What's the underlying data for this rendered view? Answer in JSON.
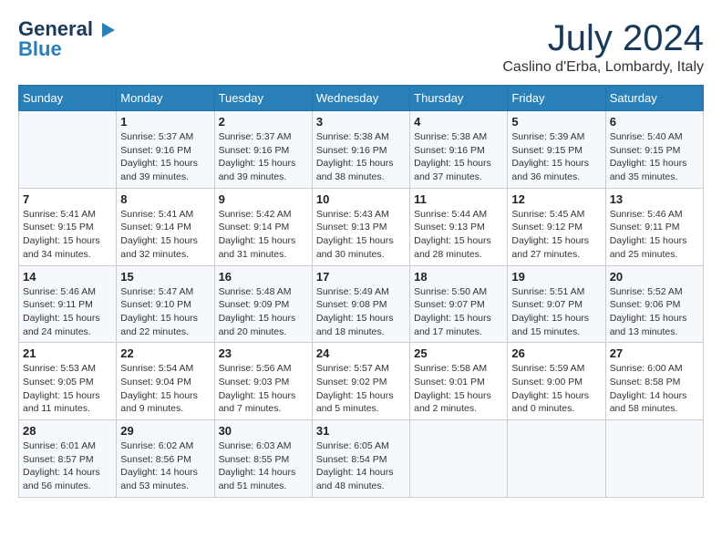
{
  "header": {
    "logo_line1": "General",
    "logo_line2": "Blue",
    "month_title": "July 2024",
    "location": "Caslino d'Erba, Lombardy, Italy"
  },
  "columns": [
    "Sunday",
    "Monday",
    "Tuesday",
    "Wednesday",
    "Thursday",
    "Friday",
    "Saturday"
  ],
  "weeks": [
    [
      {
        "num": "",
        "info": ""
      },
      {
        "num": "1",
        "info": "Sunrise: 5:37 AM\nSunset: 9:16 PM\nDaylight: 15 hours\nand 39 minutes."
      },
      {
        "num": "2",
        "info": "Sunrise: 5:37 AM\nSunset: 9:16 PM\nDaylight: 15 hours\nand 39 minutes."
      },
      {
        "num": "3",
        "info": "Sunrise: 5:38 AM\nSunset: 9:16 PM\nDaylight: 15 hours\nand 38 minutes."
      },
      {
        "num": "4",
        "info": "Sunrise: 5:38 AM\nSunset: 9:16 PM\nDaylight: 15 hours\nand 37 minutes."
      },
      {
        "num": "5",
        "info": "Sunrise: 5:39 AM\nSunset: 9:15 PM\nDaylight: 15 hours\nand 36 minutes."
      },
      {
        "num": "6",
        "info": "Sunrise: 5:40 AM\nSunset: 9:15 PM\nDaylight: 15 hours\nand 35 minutes."
      }
    ],
    [
      {
        "num": "7",
        "info": "Sunrise: 5:41 AM\nSunset: 9:15 PM\nDaylight: 15 hours\nand 34 minutes."
      },
      {
        "num": "8",
        "info": "Sunrise: 5:41 AM\nSunset: 9:14 PM\nDaylight: 15 hours\nand 32 minutes."
      },
      {
        "num": "9",
        "info": "Sunrise: 5:42 AM\nSunset: 9:14 PM\nDaylight: 15 hours\nand 31 minutes."
      },
      {
        "num": "10",
        "info": "Sunrise: 5:43 AM\nSunset: 9:13 PM\nDaylight: 15 hours\nand 30 minutes."
      },
      {
        "num": "11",
        "info": "Sunrise: 5:44 AM\nSunset: 9:13 PM\nDaylight: 15 hours\nand 28 minutes."
      },
      {
        "num": "12",
        "info": "Sunrise: 5:45 AM\nSunset: 9:12 PM\nDaylight: 15 hours\nand 27 minutes."
      },
      {
        "num": "13",
        "info": "Sunrise: 5:46 AM\nSunset: 9:11 PM\nDaylight: 15 hours\nand 25 minutes."
      }
    ],
    [
      {
        "num": "14",
        "info": "Sunrise: 5:46 AM\nSunset: 9:11 PM\nDaylight: 15 hours\nand 24 minutes."
      },
      {
        "num": "15",
        "info": "Sunrise: 5:47 AM\nSunset: 9:10 PM\nDaylight: 15 hours\nand 22 minutes."
      },
      {
        "num": "16",
        "info": "Sunrise: 5:48 AM\nSunset: 9:09 PM\nDaylight: 15 hours\nand 20 minutes."
      },
      {
        "num": "17",
        "info": "Sunrise: 5:49 AM\nSunset: 9:08 PM\nDaylight: 15 hours\nand 18 minutes."
      },
      {
        "num": "18",
        "info": "Sunrise: 5:50 AM\nSunset: 9:07 PM\nDaylight: 15 hours\nand 17 minutes."
      },
      {
        "num": "19",
        "info": "Sunrise: 5:51 AM\nSunset: 9:07 PM\nDaylight: 15 hours\nand 15 minutes."
      },
      {
        "num": "20",
        "info": "Sunrise: 5:52 AM\nSunset: 9:06 PM\nDaylight: 15 hours\nand 13 minutes."
      }
    ],
    [
      {
        "num": "21",
        "info": "Sunrise: 5:53 AM\nSunset: 9:05 PM\nDaylight: 15 hours\nand 11 minutes."
      },
      {
        "num": "22",
        "info": "Sunrise: 5:54 AM\nSunset: 9:04 PM\nDaylight: 15 hours\nand 9 minutes."
      },
      {
        "num": "23",
        "info": "Sunrise: 5:56 AM\nSunset: 9:03 PM\nDaylight: 15 hours\nand 7 minutes."
      },
      {
        "num": "24",
        "info": "Sunrise: 5:57 AM\nSunset: 9:02 PM\nDaylight: 15 hours\nand 5 minutes."
      },
      {
        "num": "25",
        "info": "Sunrise: 5:58 AM\nSunset: 9:01 PM\nDaylight: 15 hours\nand 2 minutes."
      },
      {
        "num": "26",
        "info": "Sunrise: 5:59 AM\nSunset: 9:00 PM\nDaylight: 15 hours\nand 0 minutes."
      },
      {
        "num": "27",
        "info": "Sunrise: 6:00 AM\nSunset: 8:58 PM\nDaylight: 14 hours\nand 58 minutes."
      }
    ],
    [
      {
        "num": "28",
        "info": "Sunrise: 6:01 AM\nSunset: 8:57 PM\nDaylight: 14 hours\nand 56 minutes."
      },
      {
        "num": "29",
        "info": "Sunrise: 6:02 AM\nSunset: 8:56 PM\nDaylight: 14 hours\nand 53 minutes."
      },
      {
        "num": "30",
        "info": "Sunrise: 6:03 AM\nSunset: 8:55 PM\nDaylight: 14 hours\nand 51 minutes."
      },
      {
        "num": "31",
        "info": "Sunrise: 6:05 AM\nSunset: 8:54 PM\nDaylight: 14 hours\nand 48 minutes."
      },
      {
        "num": "",
        "info": ""
      },
      {
        "num": "",
        "info": ""
      },
      {
        "num": "",
        "info": ""
      }
    ]
  ]
}
